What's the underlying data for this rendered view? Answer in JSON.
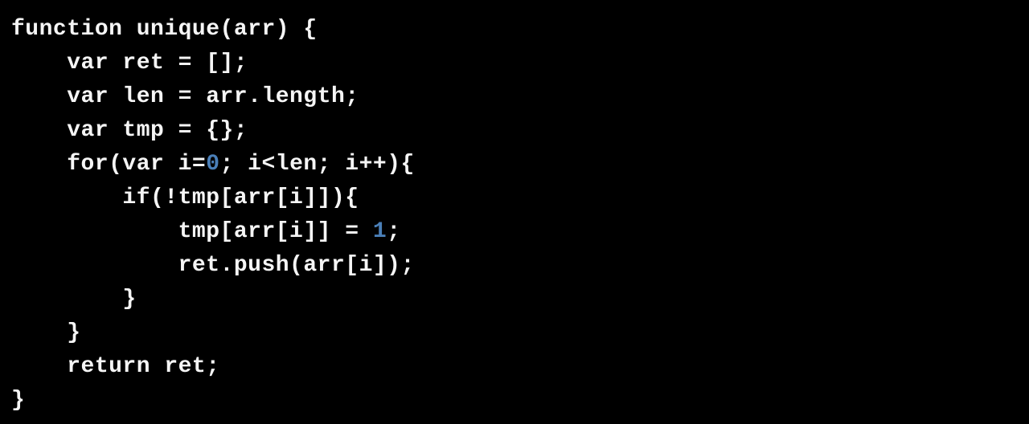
{
  "code": {
    "line1_a": "function unique(arr) {",
    "line2_a": "    var ret = [];",
    "line3_a": "    var len = arr.length;",
    "line4_a": "    var tmp = {};",
    "line5_a": "    for(var i=",
    "line5_num1": "0",
    "line5_b": "; i<len; i++){",
    "line6_a": "        if(!tmp[arr[i]]){",
    "line7_a": "            tmp[arr[i]] = ",
    "line7_num1": "1",
    "line7_b": ";",
    "line8_a": "            ret.push(arr[i]);",
    "line9_a": "        }",
    "line10_a": "    }",
    "line11_a": "    return ret;",
    "line12_a": "}"
  }
}
